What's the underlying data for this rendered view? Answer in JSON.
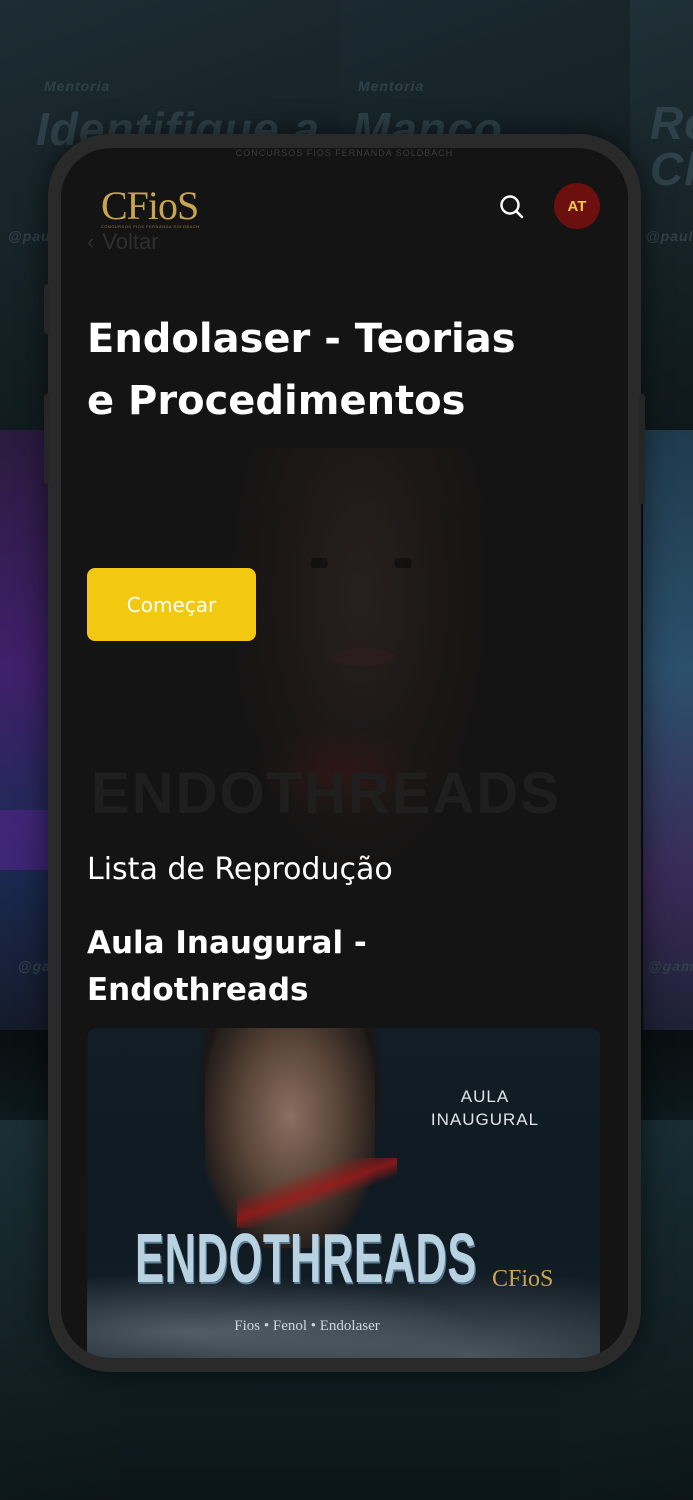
{
  "brand": {
    "logo_text": "CFioS",
    "logo_subtitle": "CONCURSOS FIOS FERNANDA SOLDBACH",
    "accent_color": "#f2c811",
    "gold_color": "#c9a553"
  },
  "header": {
    "search_icon": "search-icon",
    "avatar_initials": "AT",
    "back_label": "Voltar"
  },
  "hero": {
    "title": "Endolaser - Teorias e Procedimentos",
    "start_button": "Começar"
  },
  "playlist": {
    "heading": "Lista de Reprodução",
    "items": [
      {
        "title": "Aula Inaugural - Endothreads",
        "thumbnail": {
          "label": "AULA INAUGURAL",
          "headline": "ENDOTHREADS",
          "subtitle": "Fios • Fenol • Endolaser",
          "logo": "CFioS"
        }
      }
    ]
  },
  "background": {
    "poster_texts": [
      "Mentoria",
      "Identifique a",
      "Mentoria",
      "Manco",
      "Re Cl",
      "@paulo",
      "@paul",
      "@game",
      "@gamo"
    ]
  }
}
